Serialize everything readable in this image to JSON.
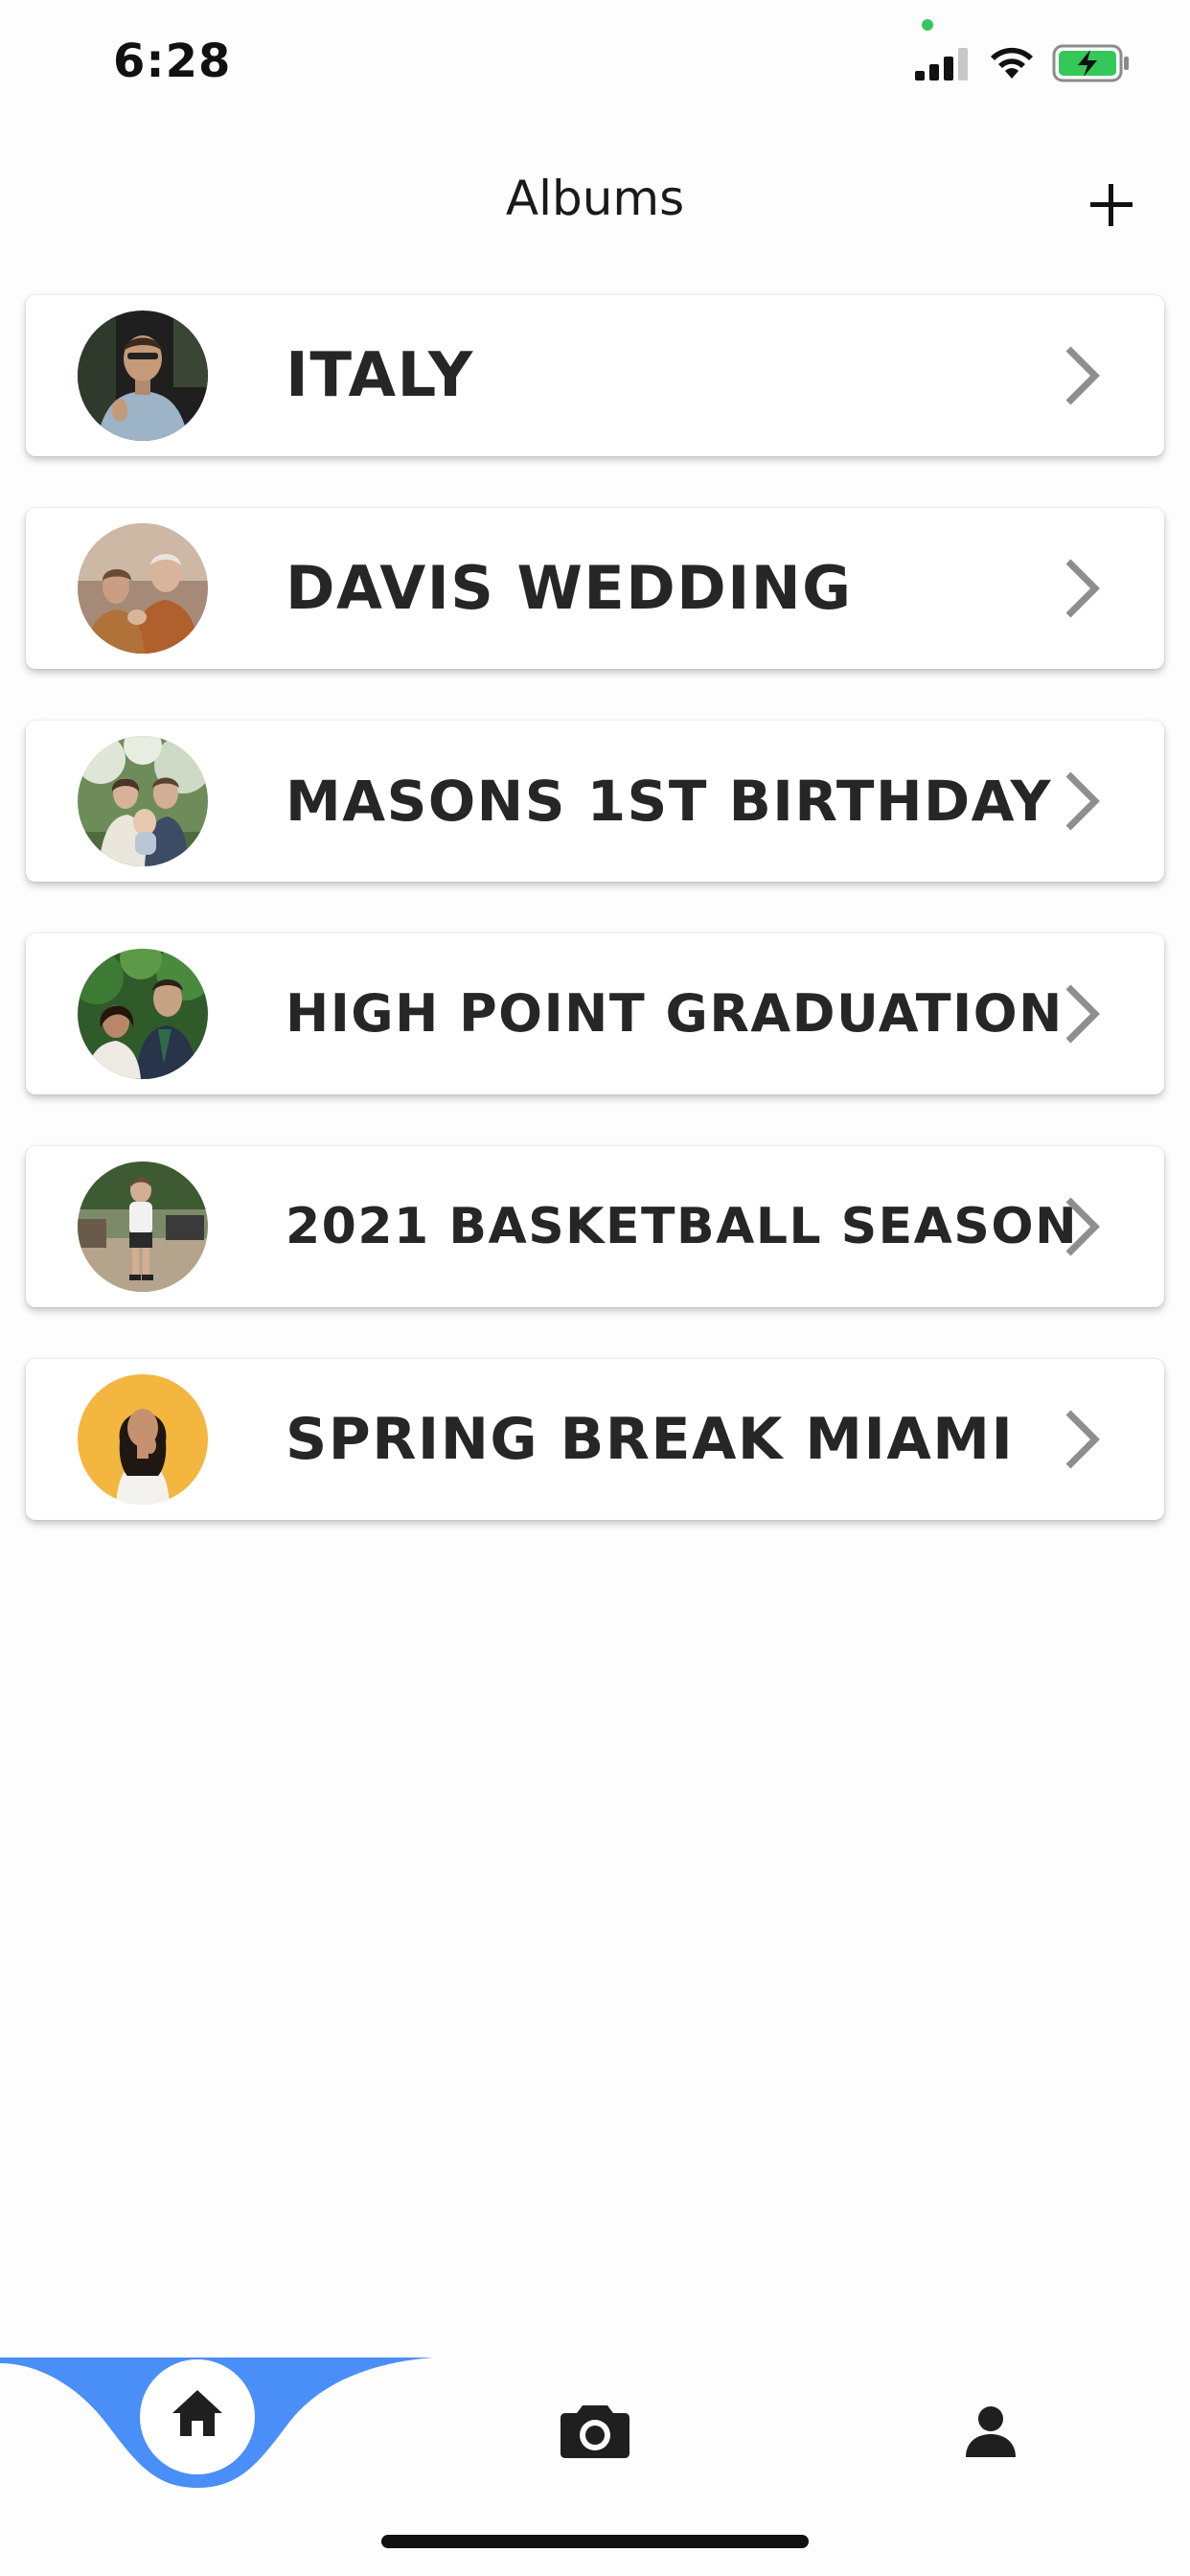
{
  "status_bar": {
    "time": "6:28",
    "icons": [
      "signal-icon",
      "wifi-icon",
      "battery-charging-icon"
    ],
    "privacy_dot_color": "#34c759",
    "battery_color": "#34c759"
  },
  "header": {
    "title": "Albums",
    "add_icon": "plus-icon"
  },
  "albums": [
    {
      "title": "ITALY",
      "thumbnail": "album-thumbnail",
      "chevron": "chevron-right-icon"
    },
    {
      "title": "DAVIS WEDDING",
      "thumbnail": "album-thumbnail",
      "chevron": "chevron-right-icon"
    },
    {
      "title": "MASONS 1ST BIRTHDAY",
      "thumbnail": "album-thumbnail",
      "chevron": "chevron-right-icon"
    },
    {
      "title": "HIGH POINT GRADUATION",
      "thumbnail": "album-thumbnail",
      "chevron": "chevron-right-icon"
    },
    {
      "title": "2021 BASKETBALL SEASON",
      "thumbnail": "album-thumbnail",
      "chevron": "chevron-right-icon"
    },
    {
      "title": "SPRING BREAK MIAMI",
      "thumbnail": "album-thumbnail",
      "chevron": "chevron-right-icon"
    }
  ],
  "bottom_nav": {
    "items": [
      "home-icon",
      "camera-icon",
      "profile-icon"
    ],
    "active": "home-icon",
    "accent_color": "#4a8ff7"
  },
  "colors": {
    "background": "#fdfdfd",
    "card": "#ffffff",
    "text": "#262626",
    "chevron": "#8e8e8e"
  }
}
